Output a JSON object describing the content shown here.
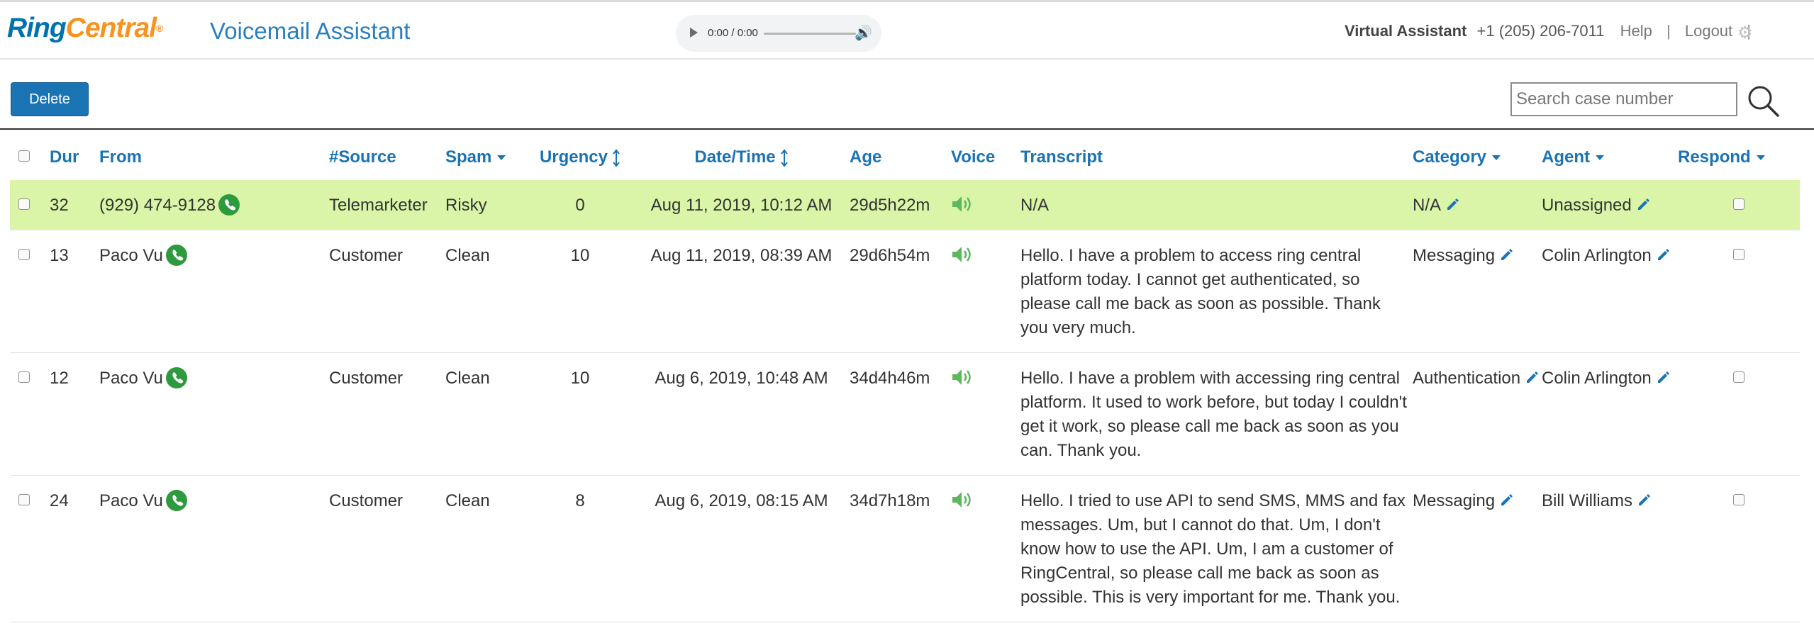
{
  "header": {
    "logo_ring": "Ring",
    "logo_central": "Central",
    "logo_reg": "®",
    "app_title": "Voicemail Assistant",
    "audio_time": "0:00 / 0:00",
    "account_label": "Virtual Assistant",
    "phone": "+1 (205) 206-7011",
    "help": "Help",
    "logout": "Logout",
    "sep": "|"
  },
  "toolbar": {
    "delete_label": "Delete",
    "search_placeholder": "Search case number"
  },
  "table": {
    "columns": {
      "dur": "Dur",
      "from": "From",
      "source": "#Source",
      "spam": "Spam",
      "urgency": "Urgency",
      "datetime": "Date/Time",
      "age": "Age",
      "voice": "Voice",
      "transcript": "Transcript",
      "category": "Category",
      "agent": "Agent",
      "respond": "Respond"
    },
    "rows": [
      {
        "dur": "32",
        "from": "(929) 474-9128",
        "source": "Telemarketer",
        "spam": "Risky",
        "urgency": "0",
        "datetime": "Aug 11, 2019, 10:12 AM",
        "age": "29d5h22m",
        "transcript": "N/A",
        "category": "N/A",
        "agent": "Unassigned"
      },
      {
        "dur": "13",
        "from": "Paco Vu",
        "source": "Customer",
        "spam": "Clean",
        "urgency": "10",
        "datetime": "Aug 11, 2019, 08:39 AM",
        "age": "29d6h54m",
        "transcript": "Hello. I have a problem to access ring central platform today. I cannot get authenticated, so please call me back as soon as possible. Thank you very much.",
        "category": "Messaging",
        "agent": "Colin Arlington"
      },
      {
        "dur": "12",
        "from": "Paco Vu",
        "source": "Customer",
        "spam": "Clean",
        "urgency": "10",
        "datetime": "Aug 6, 2019, 10:48 AM",
        "age": "34d4h46m",
        "transcript": "Hello. I have a problem with accessing ring central platform. It used to work before, but today I couldn't get it work, so please call me back as soon as you can. Thank you.",
        "category": "Authentication",
        "agent": "Colin Arlington"
      },
      {
        "dur": "24",
        "from": "Paco Vu",
        "source": "Customer",
        "spam": "Clean",
        "urgency": "8",
        "datetime": "Aug 6, 2019, 08:15 AM",
        "age": "34d7h18m",
        "transcript": "Hello. I tried to use API to send SMS, MMS and fax messages. Um, but I cannot do that. Um, I don't know how to use the API. Um, I am a customer of RingCentral, so please call me back as soon as possible. This is very important for me. Thank you.",
        "category": "Messaging",
        "agent": "Bill Williams"
      }
    ]
  },
  "colors": {
    "brand_blue": "#1a73b3",
    "brand_orange": "#f7931e",
    "row_highlight": "#dbf5a8",
    "risky": "#e02020",
    "clean": "#2a8a2a"
  },
  "icons": [
    "call-icon",
    "speaker-icon",
    "pencil-icon",
    "search-icon",
    "gear-icon",
    "play-icon",
    "volume-icon"
  ]
}
